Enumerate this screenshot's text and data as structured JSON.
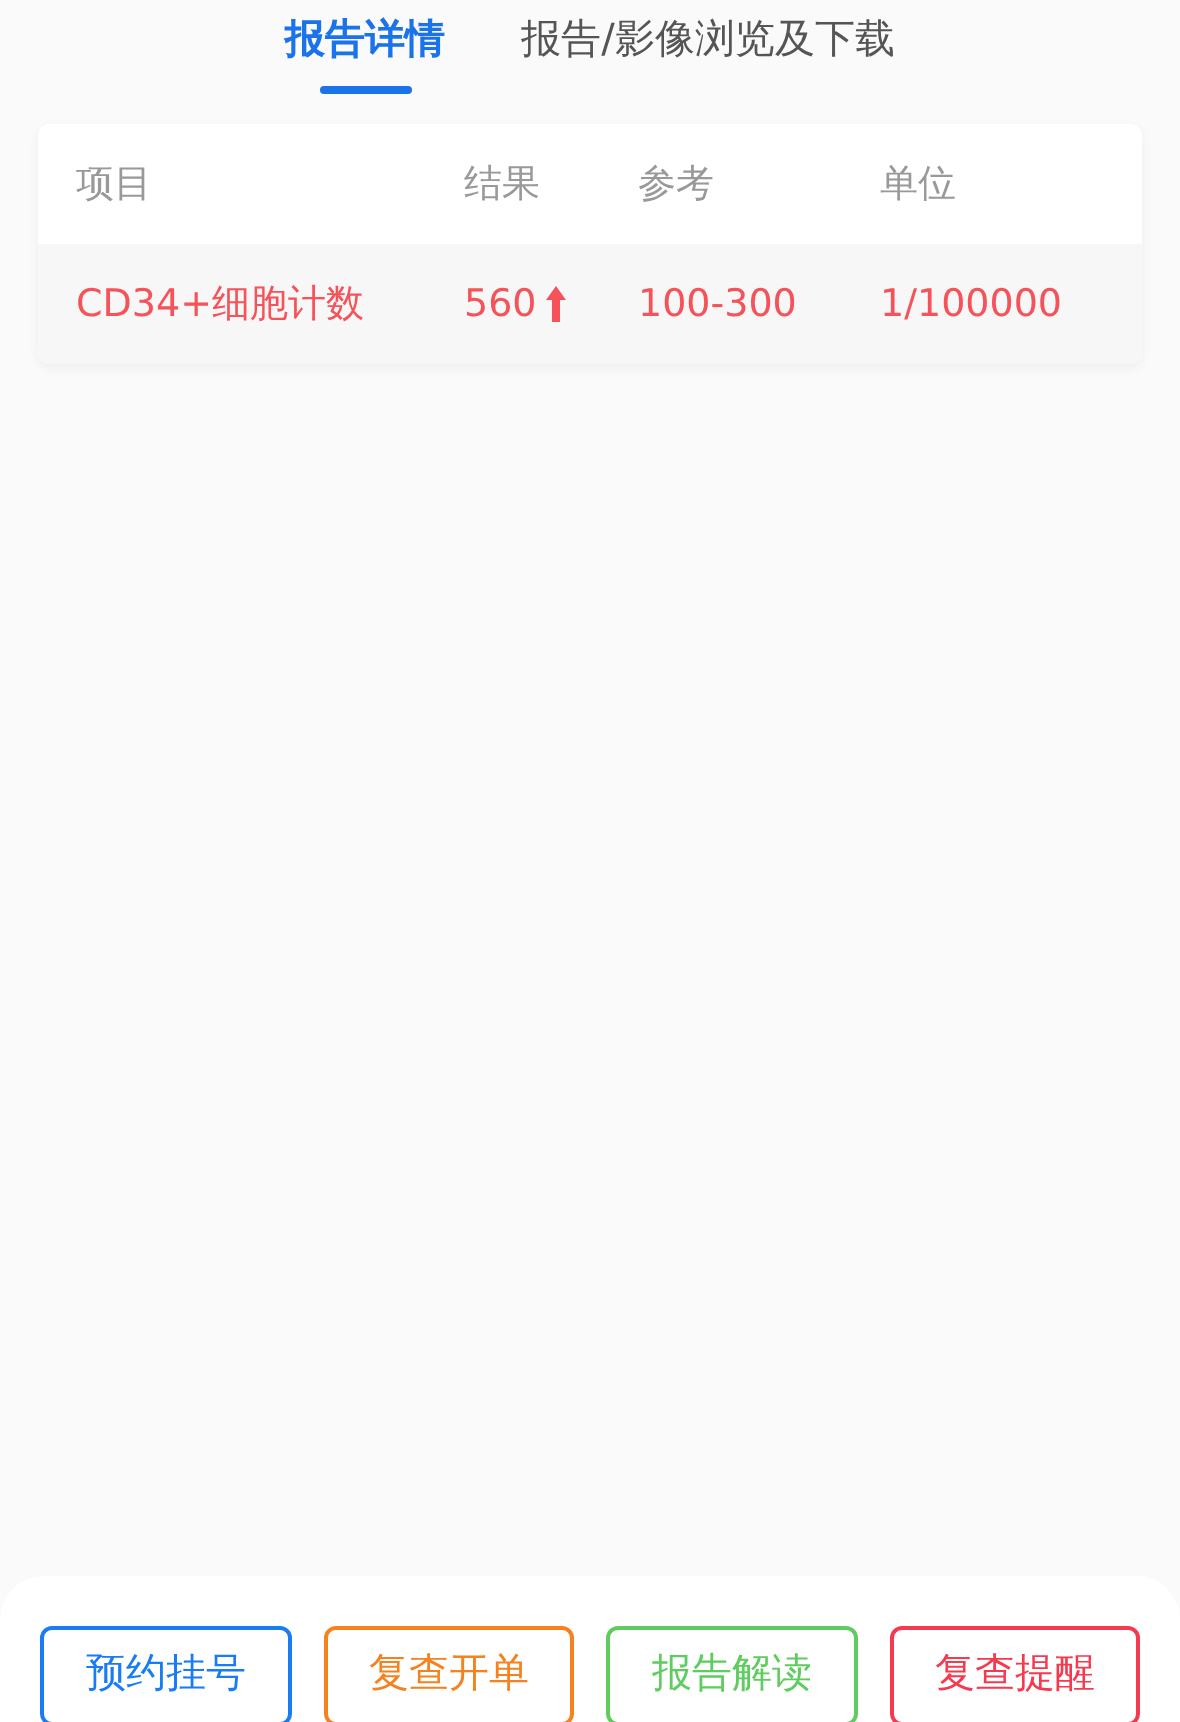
{
  "tabs": [
    {
      "label": "报告详情",
      "selected": true
    },
    {
      "label": "报告/影像浏览及下载",
      "selected": false
    }
  ],
  "table": {
    "columns": [
      "项目",
      "结果",
      "参考",
      "单位"
    ],
    "rows": [
      {
        "item": "CD34+细胞计数",
        "result": "560",
        "reference": "100-300",
        "unit": "1/100000",
        "abnormal": true
      }
    ]
  },
  "buttons": [
    {
      "label": "预约挂号",
      "color": "#1a7cf5"
    },
    {
      "label": "复查开单",
      "color": "#f5821f"
    },
    {
      "label": "报告解读",
      "color": "#5fcc5f"
    },
    {
      "label": "复查提醒",
      "color": "#f5394f"
    }
  ]
}
